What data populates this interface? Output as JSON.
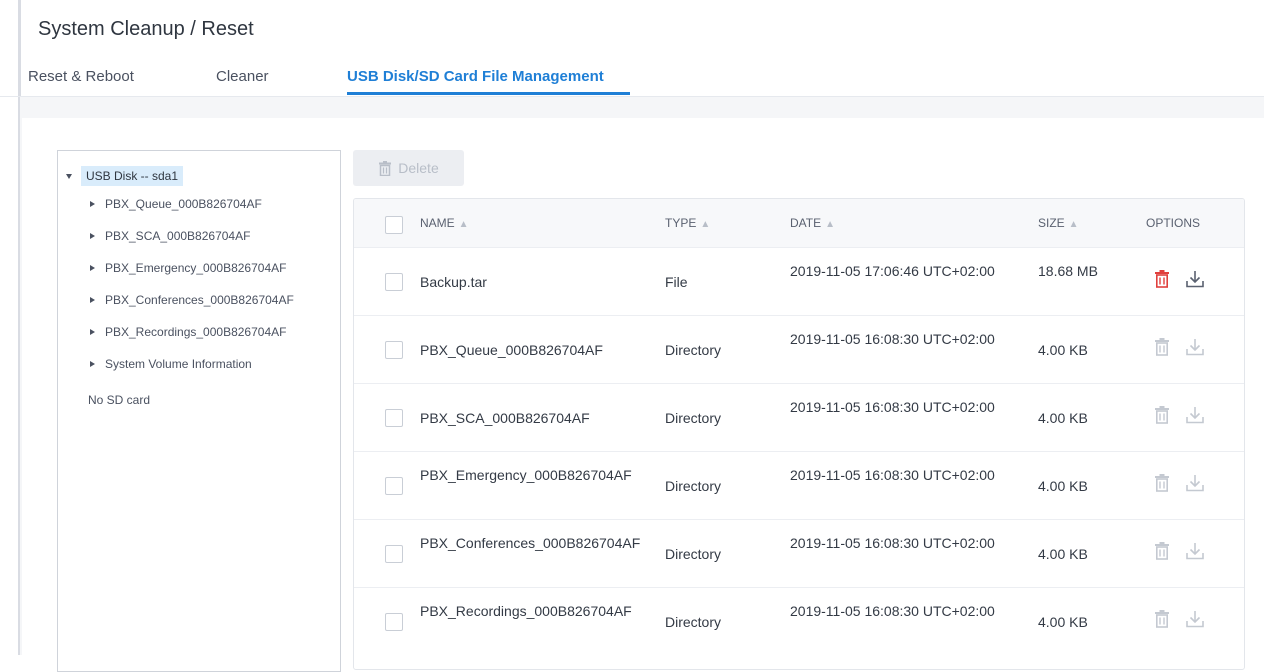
{
  "page": {
    "title": "System Cleanup / Reset"
  },
  "tabs": [
    {
      "label": "Reset & Reboot",
      "active": false
    },
    {
      "label": "Cleaner",
      "active": false
    },
    {
      "label": "USB Disk/SD Card File Management",
      "active": true
    }
  ],
  "tree": {
    "root_label": "USB Disk -- sda1",
    "items": [
      "PBX_Queue_000B826704AF",
      "PBX_SCA_000B826704AF",
      "PBX_Emergency_000B826704AF",
      "PBX_Conferences_000B826704AF",
      "PBX_Recordings_000B826704AF",
      "System Volume Information"
    ],
    "no_sd": "No SD card"
  },
  "toolbar": {
    "delete_label": "Delete"
  },
  "table": {
    "columns": {
      "name": "NAME",
      "type": "TYPE",
      "date": "DATE",
      "size": "SIZE",
      "options": "OPTIONS"
    },
    "rows": [
      {
        "name": "Backup.tar",
        "type": "File",
        "date": "2019-11-05 17:06:46 UTC+02:00",
        "size": "18.68 MB",
        "options_enabled": true
      },
      {
        "name": "PBX_Queue_000B826704AF",
        "type": "Directory",
        "date": "2019-11-05 16:08:30 UTC+02:00",
        "size": "4.00 KB",
        "options_enabled": false
      },
      {
        "name": "PBX_SCA_000B826704AF",
        "type": "Directory",
        "date": "2019-11-05 16:08:30 UTC+02:00",
        "size": "4.00 KB",
        "options_enabled": false
      },
      {
        "name": "PBX_Emergency_000B826704AF",
        "type": "Directory",
        "date": "2019-11-05 16:08:30 UTC+02:00",
        "size": "4.00 KB",
        "options_enabled": false
      },
      {
        "name": "PBX_Conferences_000B826704AF",
        "type": "Directory",
        "date": "2019-11-05 16:08:30 UTC+02:00",
        "size": "4.00 KB",
        "options_enabled": false
      },
      {
        "name": "PBX_Recordings_000B826704AF",
        "type": "Directory",
        "date": "2019-11-05 16:08:30 UTC+02:00",
        "size": "4.00 KB",
        "options_enabled": false
      }
    ]
  },
  "colors": {
    "accent": "#1f7fd6",
    "danger": "#e0403d",
    "muted": "#c4c9d1",
    "tree_selected": "#d9ecfb"
  },
  "icons": {
    "delete": "trash-icon",
    "download": "download-icon",
    "expand": "caret-icon"
  }
}
